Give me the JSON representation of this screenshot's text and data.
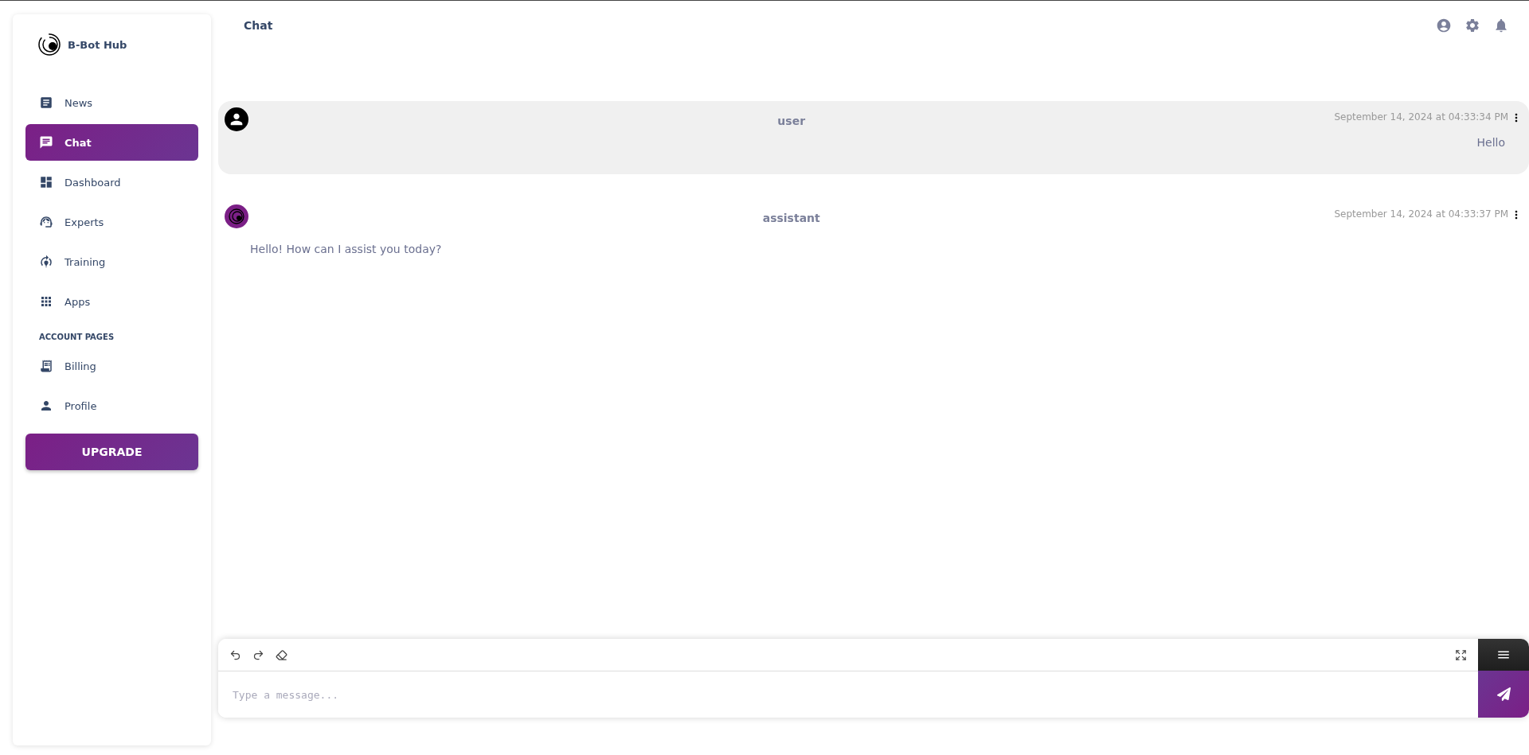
{
  "sidebar": {
    "brand": "B-Bot Hub",
    "items": [
      {
        "label": "News",
        "selected": false
      },
      {
        "label": "Chat",
        "selected": true
      },
      {
        "label": "Dashboard",
        "selected": false
      },
      {
        "label": "Experts",
        "selected": false
      },
      {
        "label": "Training",
        "selected": false
      },
      {
        "label": "Apps",
        "selected": false
      }
    ],
    "section_label": "ACCOUNT PAGES",
    "account_items": [
      {
        "label": "Billing",
        "selected": false
      },
      {
        "label": "Profile",
        "selected": false
      }
    ],
    "upgrade_button": "UPGRADE"
  },
  "header": {
    "title": "Chat"
  },
  "messages": [
    {
      "kind": "user",
      "author": "user",
      "timestamp": "September 14, 2024 at 04:33:34 PM",
      "text": "Hello"
    },
    {
      "kind": "assistant",
      "author": "assistant",
      "timestamp": "September 14, 2024 at 04:33:37 PM",
      "text": "Hello! How can I assist you today?"
    }
  ],
  "composer": {
    "placeholder": "Type a message..."
  }
}
